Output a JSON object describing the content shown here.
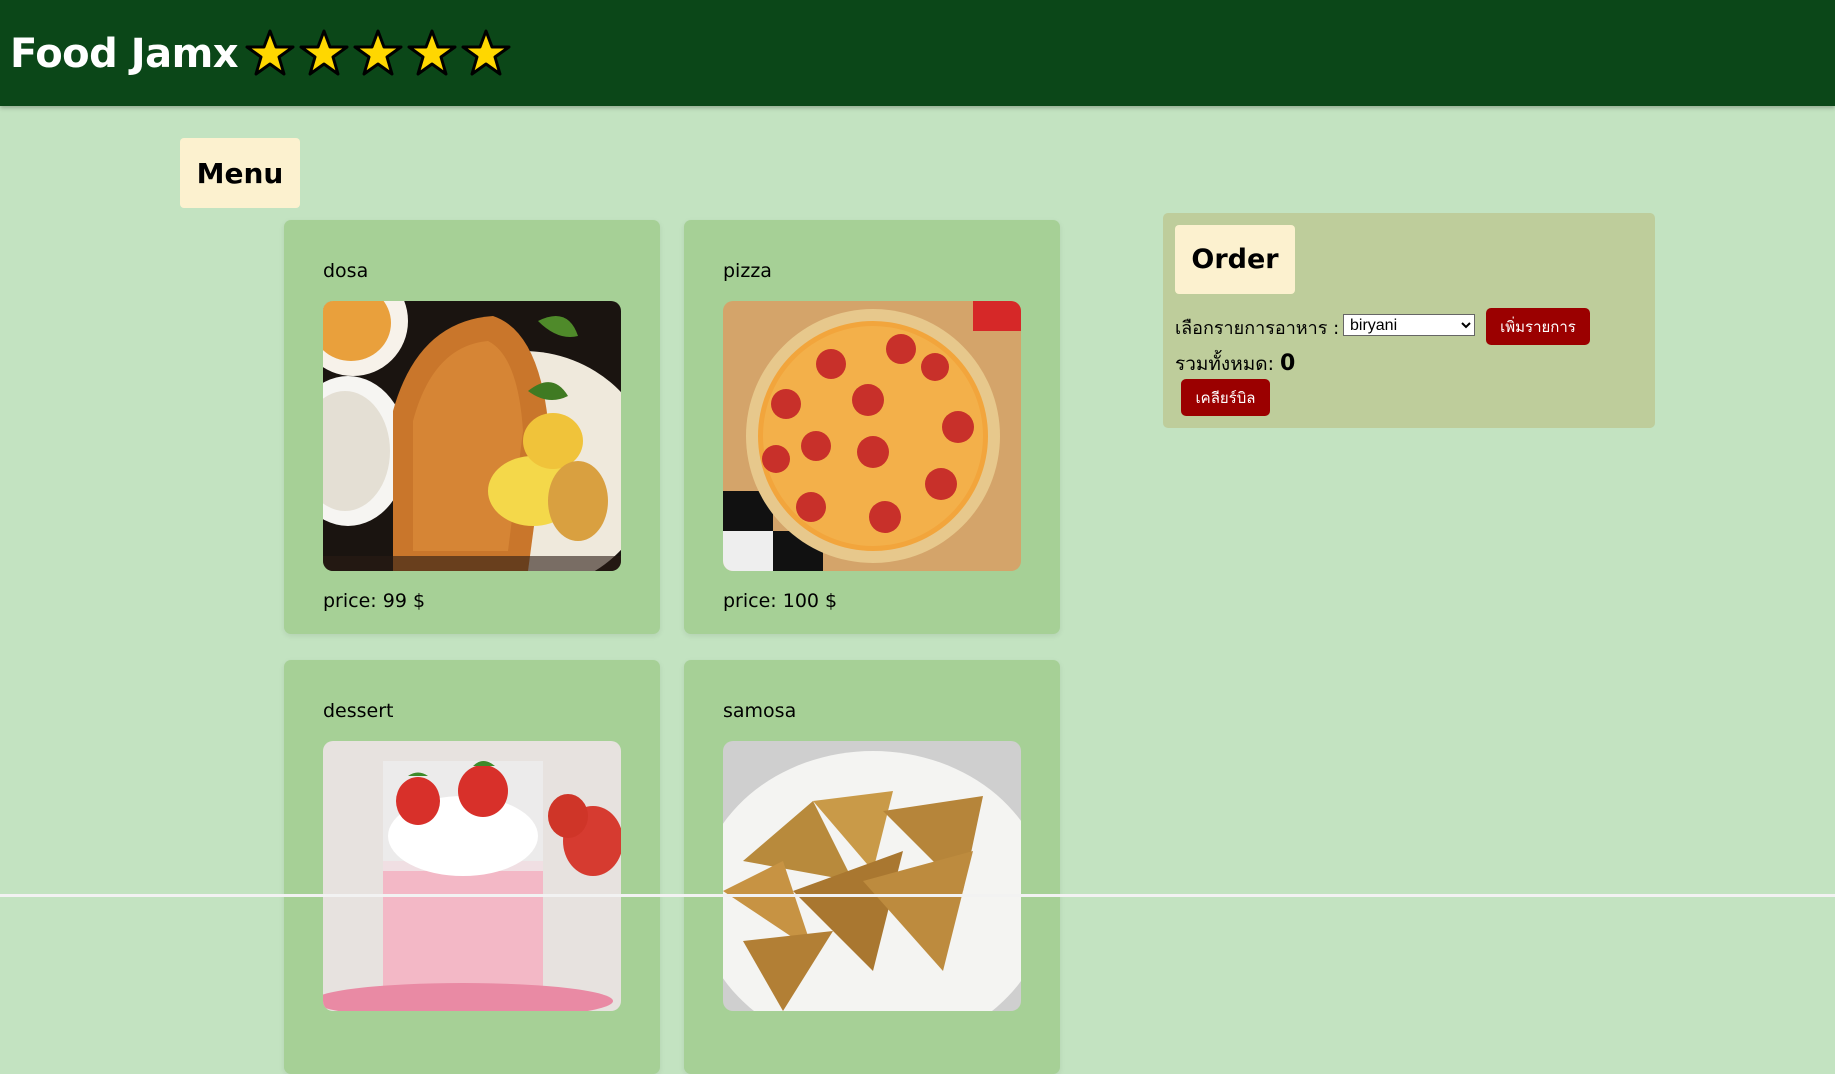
{
  "header": {
    "title": "Food Jamx",
    "star_count": 5,
    "colors": {
      "bar": "#0b4718",
      "star_fill": "#ffd700"
    }
  },
  "menu": {
    "heading": "Menu",
    "items": [
      {
        "name": "dosa",
        "price": "price: 99 $",
        "image_icon": "dosa-photo"
      },
      {
        "name": "pizza",
        "price": "price: 100 $",
        "image_icon": "pizza-photo"
      },
      {
        "name": "dessert",
        "price": "",
        "image_icon": "dessert-photo"
      },
      {
        "name": "samosa",
        "price": "",
        "image_icon": "samosa-photo"
      }
    ]
  },
  "order": {
    "heading": "Order",
    "select_label": "เลือกรายการอาหาร :",
    "selected_option": "biryani",
    "add_button": "เพิ่มรายการ",
    "total_label": "รวมทั้งหมด:",
    "total_value": "0",
    "clear_button": "เคลียร์บิล"
  },
  "colors": {
    "page_bg": "#c3e3c1",
    "card_bg": "#a6d096",
    "heading_bg": "#fcf1cf",
    "order_bg": "#becd9b",
    "button_bg": "#9b0000"
  }
}
